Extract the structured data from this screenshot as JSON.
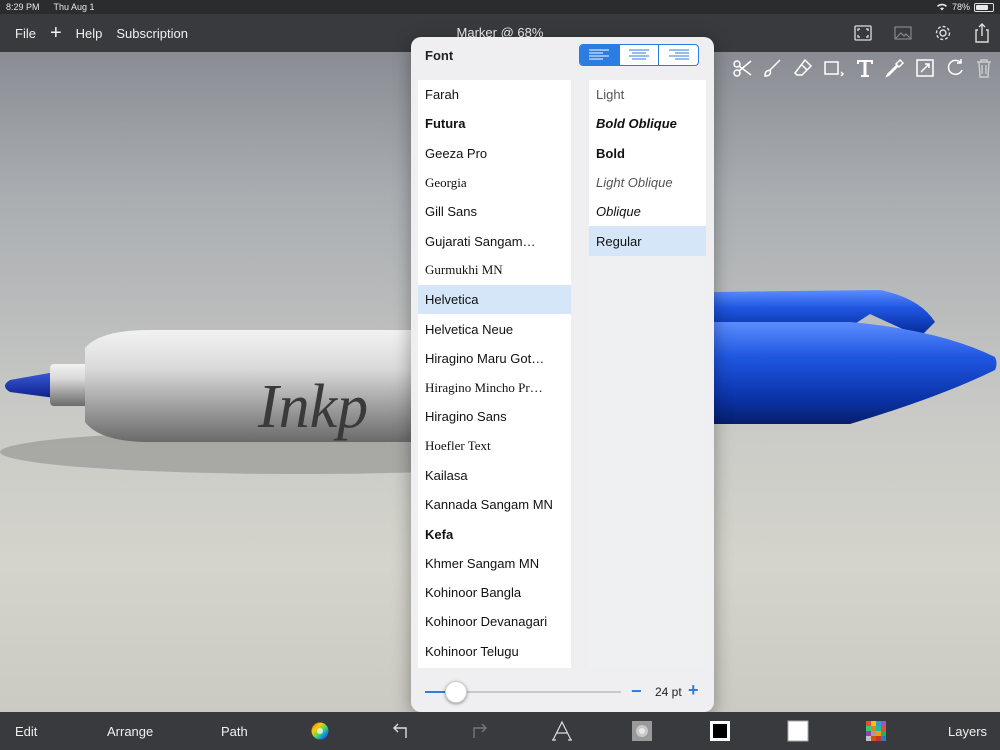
{
  "status": {
    "time": "8:29 PM",
    "date": "Thu Aug 1",
    "battery": "78%",
    "battery_level": 0.78
  },
  "topbar": {
    "menu": [
      "File",
      "+",
      "Help",
      "Subscription"
    ],
    "title": "Marker @ 68%"
  },
  "canvas": {
    "pen_text": "Inkp"
  },
  "popover": {
    "title": "Font",
    "alignment_selected": "left",
    "fonts": [
      {
        "label": "Farah",
        "family": "sans-serif",
        "weight": "normal",
        "style": "normal"
      },
      {
        "label": "Futura",
        "family": "sans-serif",
        "weight": "bold",
        "style": "normal"
      },
      {
        "label": "Geeza Pro",
        "family": "sans-serif",
        "weight": "normal",
        "style": "normal"
      },
      {
        "label": "Georgia",
        "family": "serif",
        "weight": "normal",
        "style": "normal"
      },
      {
        "label": "Gill Sans",
        "family": "sans-serif",
        "weight": "normal",
        "style": "normal"
      },
      {
        "label": "Gujarati Sangam…",
        "family": "sans-serif",
        "weight": "normal",
        "style": "normal"
      },
      {
        "label": "Gurmukhi MN",
        "family": "serif",
        "weight": "normal",
        "style": "normal"
      },
      {
        "label": "Helvetica",
        "family": "sans-serif",
        "weight": "normal",
        "style": "normal"
      },
      {
        "label": "Helvetica Neue",
        "family": "sans-serif",
        "weight": "normal",
        "style": "normal"
      },
      {
        "label": "Hiragino Maru Got…",
        "family": "sans-serif",
        "weight": "normal",
        "style": "normal"
      },
      {
        "label": "Hiragino Mincho Pr…",
        "family": "serif",
        "weight": "normal",
        "style": "normal"
      },
      {
        "label": "Hiragino Sans",
        "family": "sans-serif",
        "weight": "normal",
        "style": "normal"
      },
      {
        "label": "Hoefler Text",
        "family": "serif",
        "weight": "normal",
        "style": "normal"
      },
      {
        "label": "Kailasa",
        "family": "sans-serif",
        "weight": "normal",
        "style": "normal"
      },
      {
        "label": "Kannada Sangam MN",
        "family": "sans-serif",
        "weight": "normal",
        "style": "normal"
      },
      {
        "label": "Kefa",
        "family": "sans-serif",
        "weight": "bold",
        "style": "normal"
      },
      {
        "label": "Khmer Sangam MN",
        "family": "sans-serif",
        "weight": "normal",
        "style": "normal"
      },
      {
        "label": "Kohinoor Bangla",
        "family": "sans-serif",
        "weight": "normal",
        "style": "normal"
      },
      {
        "label": "Kohinoor Devanagari",
        "family": "sans-serif",
        "weight": "normal",
        "style": "normal"
      },
      {
        "label": "Kohinoor Telugu",
        "family": "sans-serif",
        "weight": "normal",
        "style": "normal"
      }
    ],
    "selected_font": "Helvetica",
    "styles": [
      {
        "label": "Light",
        "weight": "normal",
        "style": "normal"
      },
      {
        "label": "Bold Oblique",
        "weight": "bold",
        "style": "italic"
      },
      {
        "label": "Bold",
        "weight": "bold",
        "style": "normal"
      },
      {
        "label": "Light Oblique",
        "weight": "normal",
        "style": "italic"
      },
      {
        "label": "Oblique",
        "weight": "normal",
        "style": "italic"
      },
      {
        "label": "Regular",
        "weight": "normal",
        "style": "normal"
      }
    ],
    "selected_style": "Regular",
    "size_value": "24 pt",
    "size_minus": "−",
    "size_plus": "+",
    "size_slider_fraction": 0.16
  },
  "bottombar": {
    "edit": "Edit",
    "arrange": "Arrange",
    "path": "Path",
    "layers": "Layers"
  },
  "colors": {
    "accent": "#2b7de1",
    "pen_blue": "#1f56e0",
    "bar": "#393a3d"
  }
}
